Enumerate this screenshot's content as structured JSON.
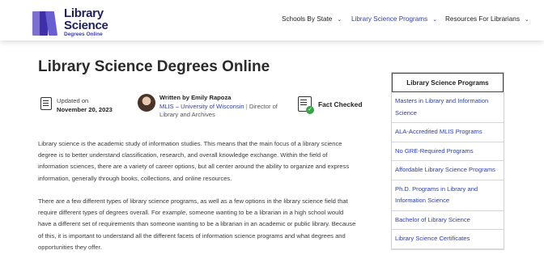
{
  "logo": {
    "line1": "Library",
    "line2": "Science",
    "tagline": "Degrees Online"
  },
  "nav": {
    "items": [
      {
        "label": "Schools By State"
      },
      {
        "label": "Library Science Programs"
      },
      {
        "label": "Resources For Librarians"
      }
    ],
    "active_color": "#2c3fa8"
  },
  "page_title": "Library Science Degrees Online",
  "meta": {
    "updated_label": "Updated on",
    "updated_date": "November 20, 2023",
    "author_prefix": "Written by Emily Rapoza",
    "author_affiliation": "MLIS – University of Wisconsin",
    "author_separator": "|",
    "author_role": "Director of Library and Archives",
    "fact_checked": "Fact Checked"
  },
  "content": {
    "paragraph1": "Library science is the academic study of information studies. This means that the main focus of a library science degree is to better understand classification, research, and overall knowledge exchange. Within the field of information sciences, there are a variety of career options, but all center around the ability to organize and express information, generally through books, collections, and online resources.",
    "paragraph2": "There are a few different types of library science programs, as well as a few options in the library science field that require different types of degrees overall. For example, someone wanting to be a librarian in a high school would have a different set of requirements than someone wanting to be a librarian in an academic or public library. Because of this, it is important to understand all the different facets of information science programs and what degrees and opportunities they offer."
  },
  "sidebar": {
    "title": "Library Science Programs",
    "items": [
      {
        "label": "Masters in Library and Information Science"
      },
      {
        "label": "ALA-Accredited MLIS Programs"
      },
      {
        "label": "No GRE-Required Programs"
      },
      {
        "label": "Affordable Library Science Programs"
      },
      {
        "label": "Ph.D. Programs in Library and Information Science"
      },
      {
        "label": "Bachelor of Library Science"
      },
      {
        "label": "Library Science Certificates"
      }
    ]
  }
}
